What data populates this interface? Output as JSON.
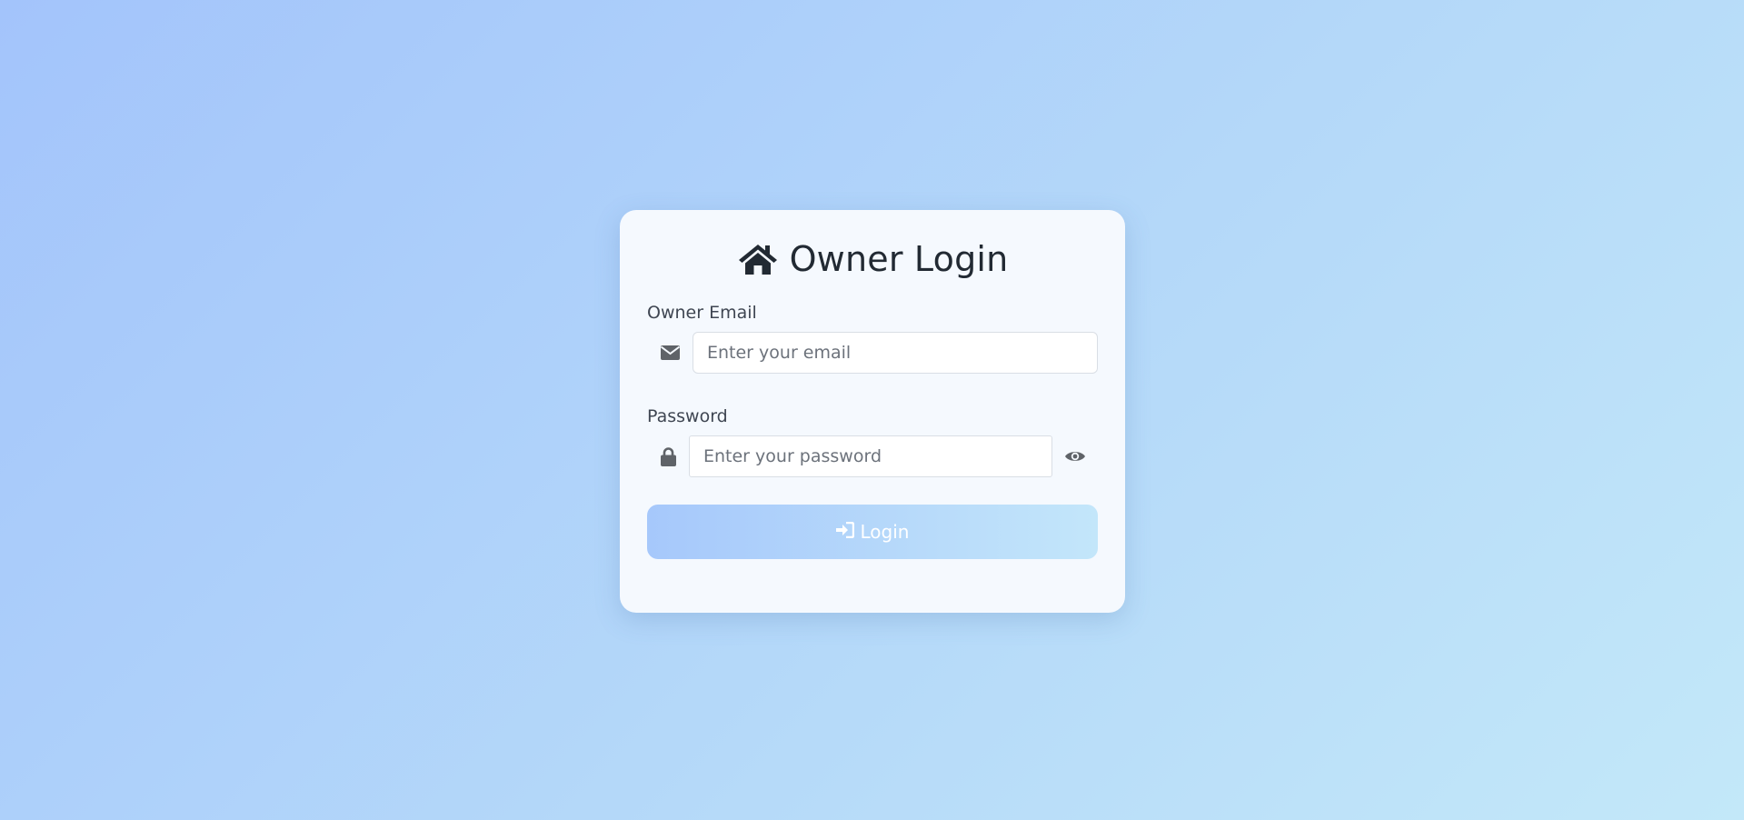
{
  "header": {
    "icon": "home-icon",
    "title": "Owner Login"
  },
  "form": {
    "email": {
      "label": "Owner Email",
      "icon": "envelope-icon",
      "value": "",
      "placeholder": "Enter your email"
    },
    "password": {
      "label": "Password",
      "icon": "lock-icon",
      "value": "",
      "placeholder": "Enter your password",
      "toggle_icon": "eye-icon"
    },
    "submit": {
      "icon": "sign-in-icon",
      "label": "Login"
    }
  },
  "colors": {
    "background_start": "#a3c4fb",
    "background_end": "#c3e8f9",
    "card": "#f5f9fe",
    "title_text": "#222a33",
    "icon": "#5f6368",
    "button_start": "#a6c8fb",
    "button_end": "#c3e6fa"
  }
}
